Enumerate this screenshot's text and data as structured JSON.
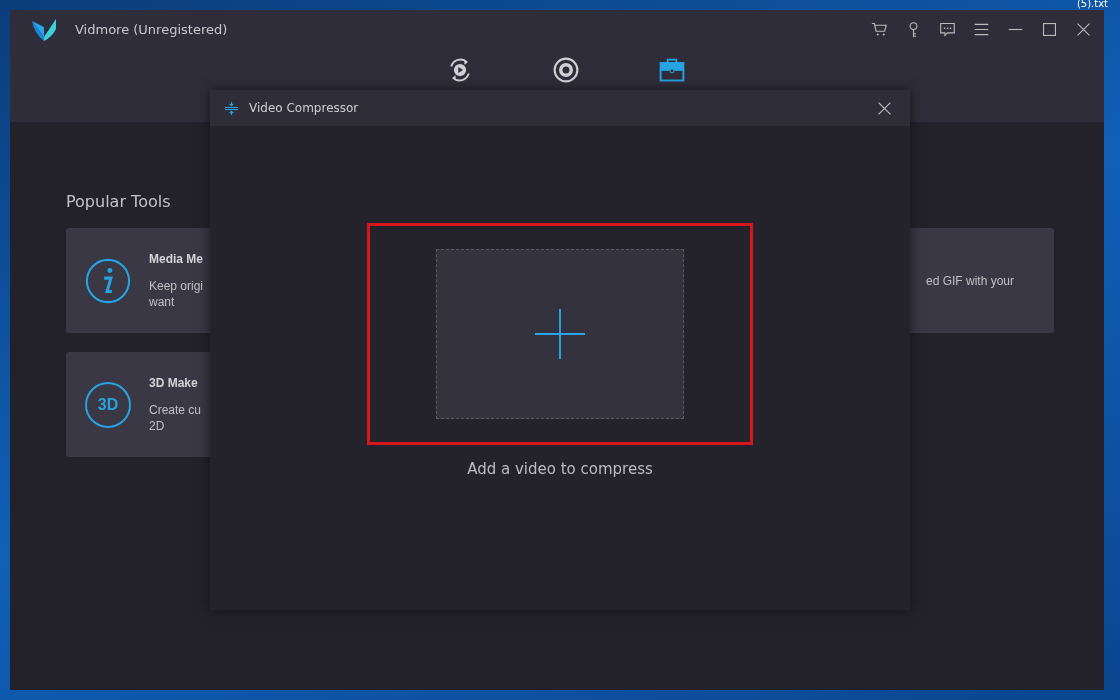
{
  "desktop": {
    "file_label": "(5).txt"
  },
  "window": {
    "title": "Vidmore (Unregistered)"
  },
  "nav_tabs": [
    {
      "kind": "converter",
      "selected": false
    },
    {
      "kind": "recorder",
      "selected": false
    },
    {
      "kind": "toolbox",
      "selected": true
    }
  ],
  "popular_tools": {
    "heading": "Popular Tools",
    "left_cards": [
      {
        "kind": "info",
        "title": "Media Me",
        "description_lines": [
          "Keep origi",
          "want"
        ]
      },
      {
        "kind": "threed",
        "icon_text": "3D",
        "title": "3D Make",
        "description_lines": [
          "Create cu",
          "2D"
        ]
      }
    ],
    "right_cards": [
      {
        "description_lines": [
          "ed GIF with your"
        ]
      }
    ]
  },
  "dialog": {
    "title": "Video Compressor",
    "drop_hint": "Add a video to compress",
    "highlighted": true
  }
}
